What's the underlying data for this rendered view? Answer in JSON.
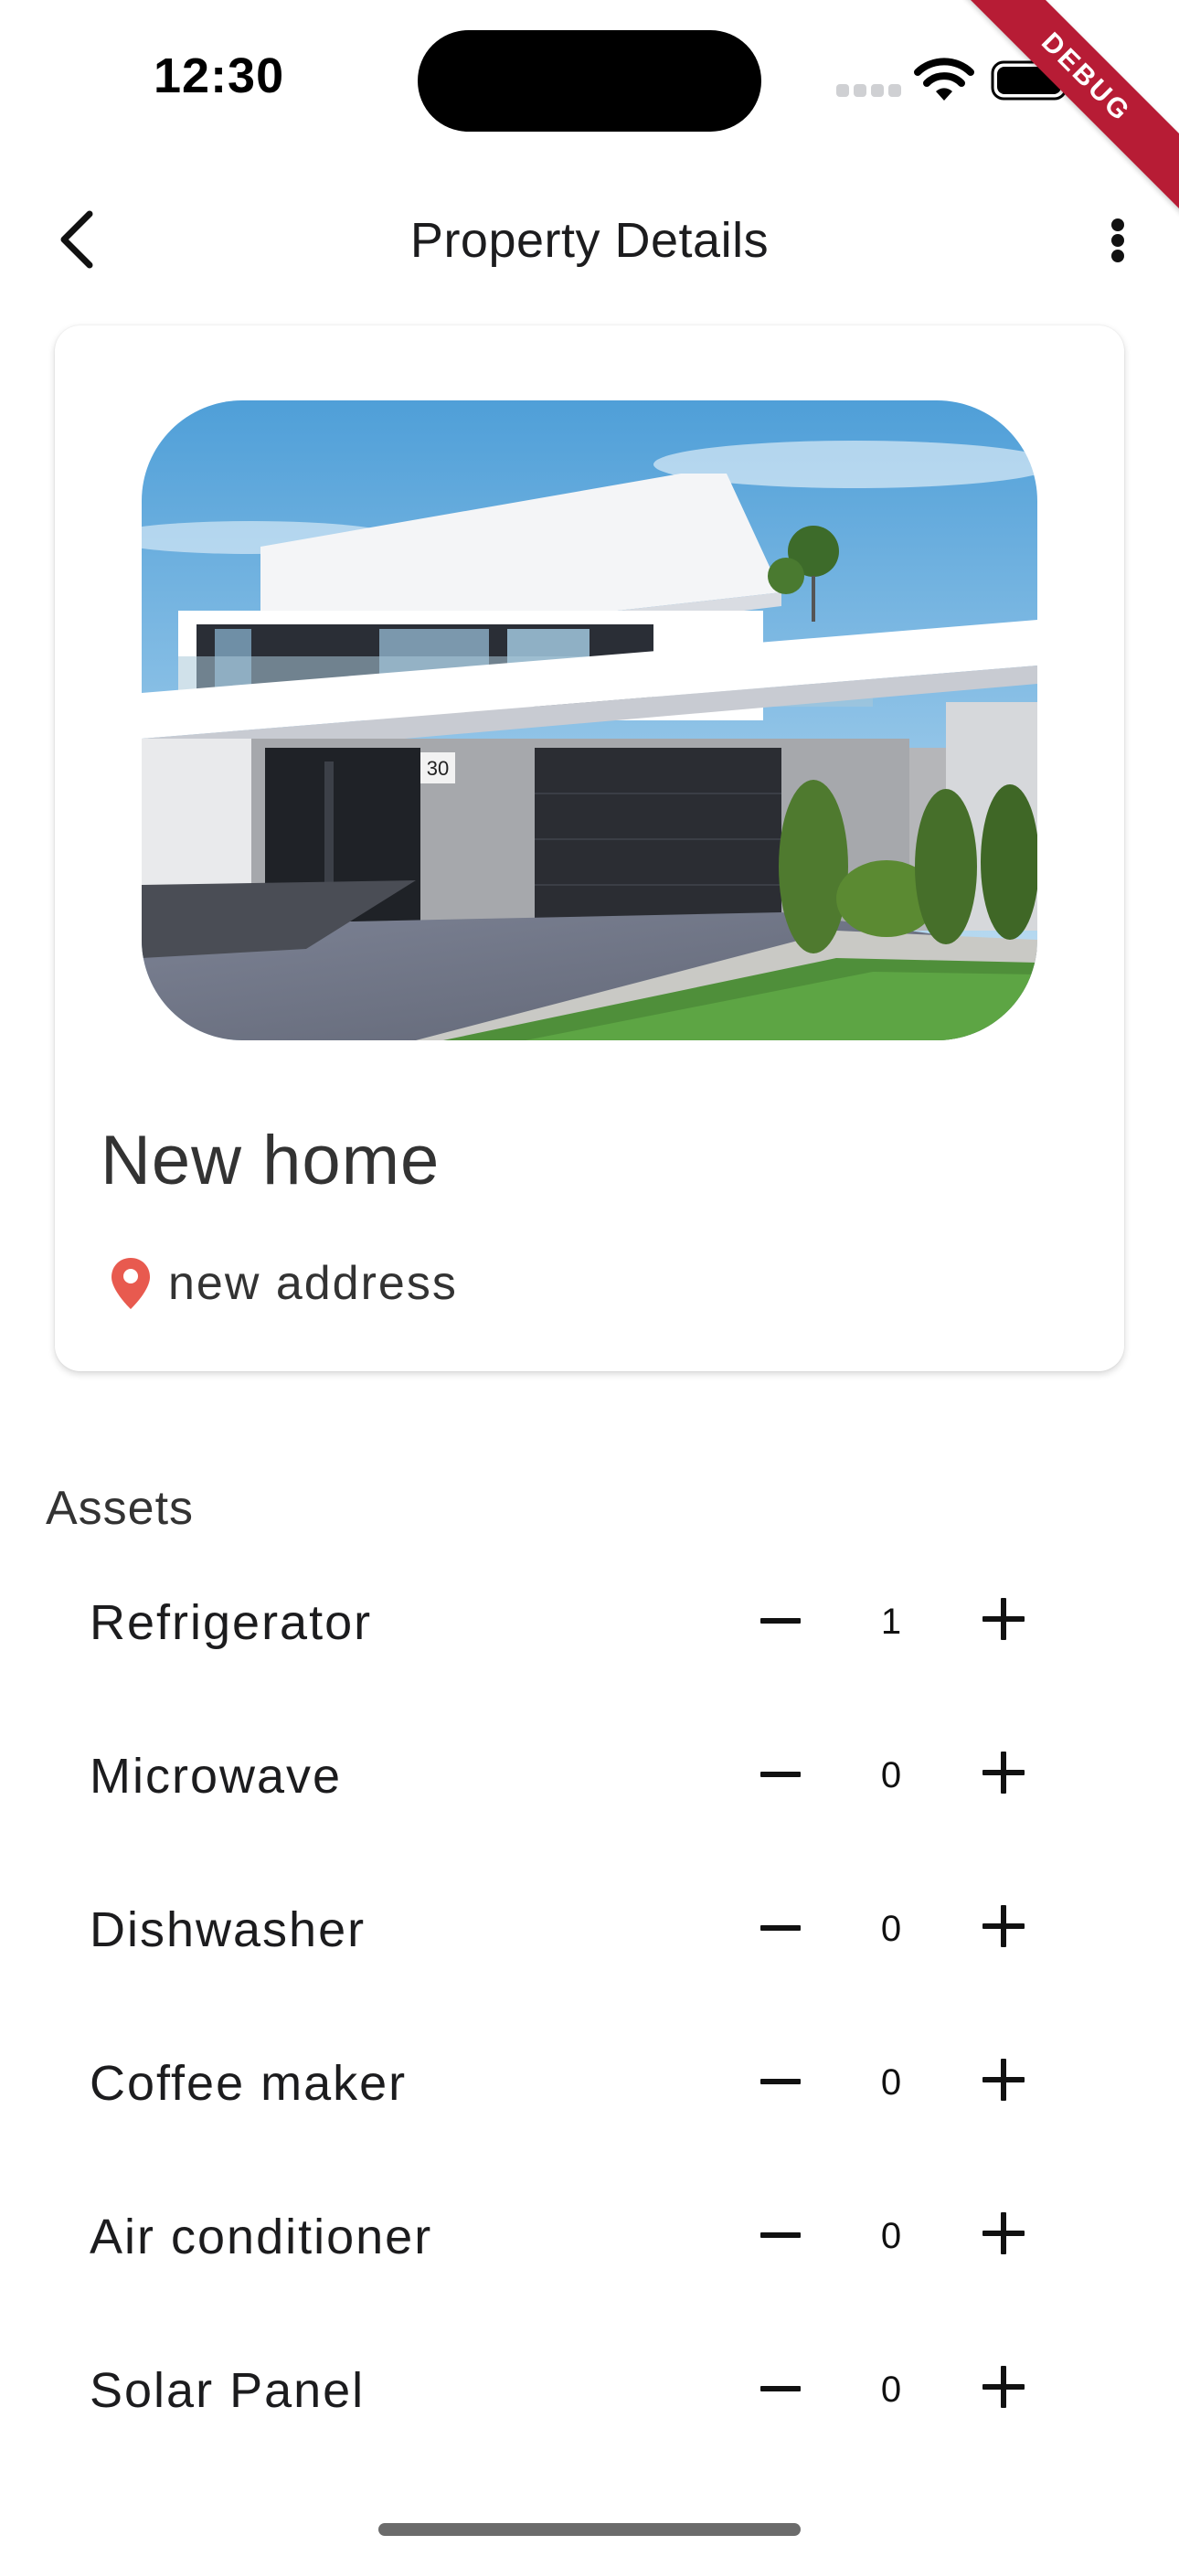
{
  "status_bar": {
    "time": "12:30",
    "debug_label": "DEBUG"
  },
  "app_bar": {
    "title": "Property Details",
    "back_icon": "chevron-left-icon",
    "more_icon": "more-vertical-icon"
  },
  "property": {
    "name": "New home",
    "address": "new address",
    "location_icon": "location-pin-icon",
    "pin_color": "#e85a4f",
    "image_house_number": "30"
  },
  "assets": {
    "heading": "Assets",
    "items": [
      {
        "label": "Refrigerator",
        "count": "1"
      },
      {
        "label": "Microwave",
        "count": "0"
      },
      {
        "label": "Dishwasher",
        "count": "0"
      },
      {
        "label": "Coffee maker",
        "count": "0"
      },
      {
        "label": "Air conditioner",
        "count": "0"
      },
      {
        "label": "Solar Panel",
        "count": "0"
      }
    ]
  }
}
